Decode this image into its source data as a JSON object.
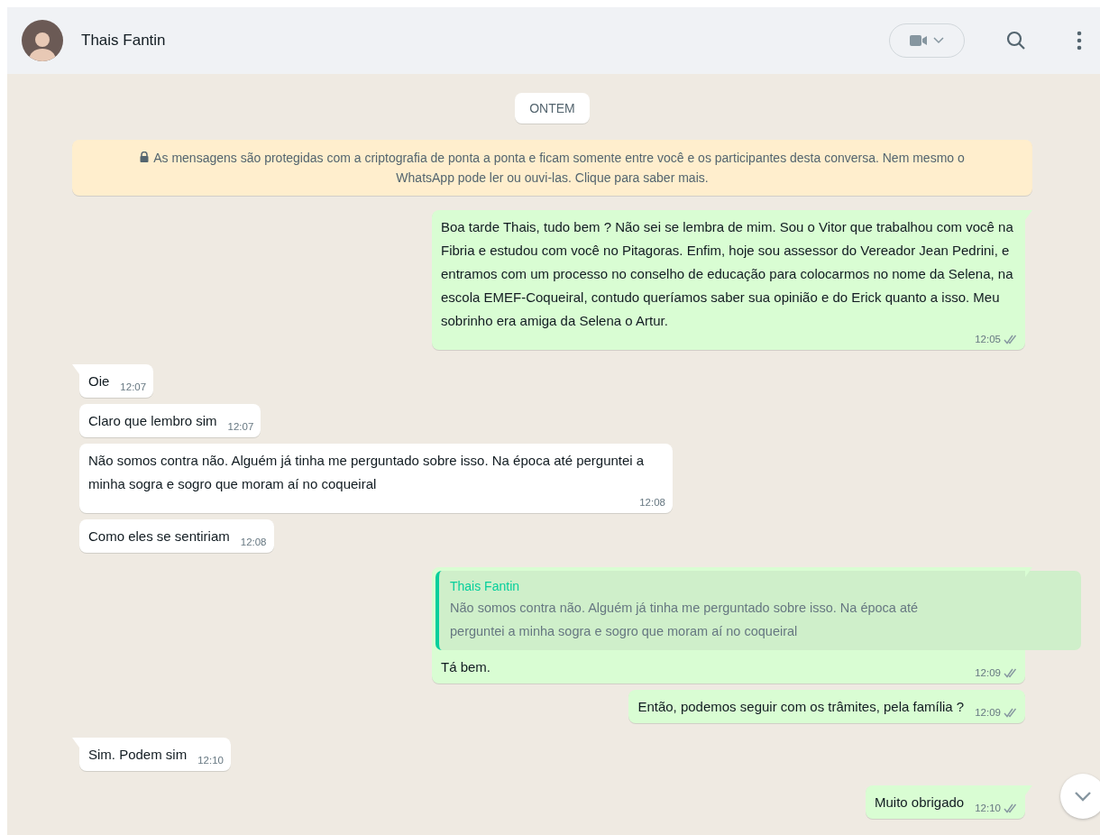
{
  "header": {
    "contact_name": "Thais Fantin"
  },
  "date_chip": "ONTEM",
  "encryption_notice": "As mensagens são protegidas com a criptografia de ponta a ponta e ficam somente entre você e os participantes desta conversa. Nem mesmo o WhatsApp pode ler ou ouvi-las. Clique para saber mais.",
  "messages": [
    {
      "kind": "outgoing",
      "tail": true,
      "text": "Boa tarde Thais, tudo bem ? Não sei se lembra de mim. Sou o Vitor que trabalhou com você  na Fibria e estudou com você no Pitagoras. Enfim, hoje sou assessor do Vereador Jean Pedrini, e entramos com um processo no conselho de educação para colocarmos no nome da Selena, na escola EMEF-Coqueiral, contudo queríamos saber sua opinião e do Erick quanto a isso. Meu sobrinho era amiga da Selena o Artur.",
      "time": "12:05"
    },
    {
      "kind": "incoming",
      "tail": true,
      "text": "Oie",
      "time": "12:07"
    },
    {
      "kind": "incoming",
      "tail": false,
      "text": "Claro que lembro sim",
      "time": "12:07"
    },
    {
      "kind": "incoming",
      "tail": false,
      "text": "Não somos contra não. Alguém já tinha me perguntado sobre isso. Na época até perguntei a minha sogra e sogro que moram aí no coqueiral",
      "time": "12:08"
    },
    {
      "kind": "incoming",
      "tail": false,
      "text": "Como eles se sentiriam",
      "time": "12:08"
    },
    {
      "kind": "outgoing",
      "tail": true,
      "quote": {
        "author": "Thais Fantin",
        "text": "Não somos contra não. Alguém já tinha me perguntado sobre isso. Na época até perguntei a minha sogra e sogro que moram aí no coqueiral"
      },
      "text": "Tá bem.",
      "time": "12:09"
    },
    {
      "kind": "outgoing",
      "tail": false,
      "text": "Então, podemos seguir com os trâmites, pela família ?",
      "time": "12:09"
    },
    {
      "kind": "incoming",
      "tail": true,
      "text": "Sim. Podem sim",
      "time": "12:10"
    },
    {
      "kind": "outgoing",
      "tail": true,
      "text": "Muito obrigado",
      "time": "12:10"
    }
  ]
}
